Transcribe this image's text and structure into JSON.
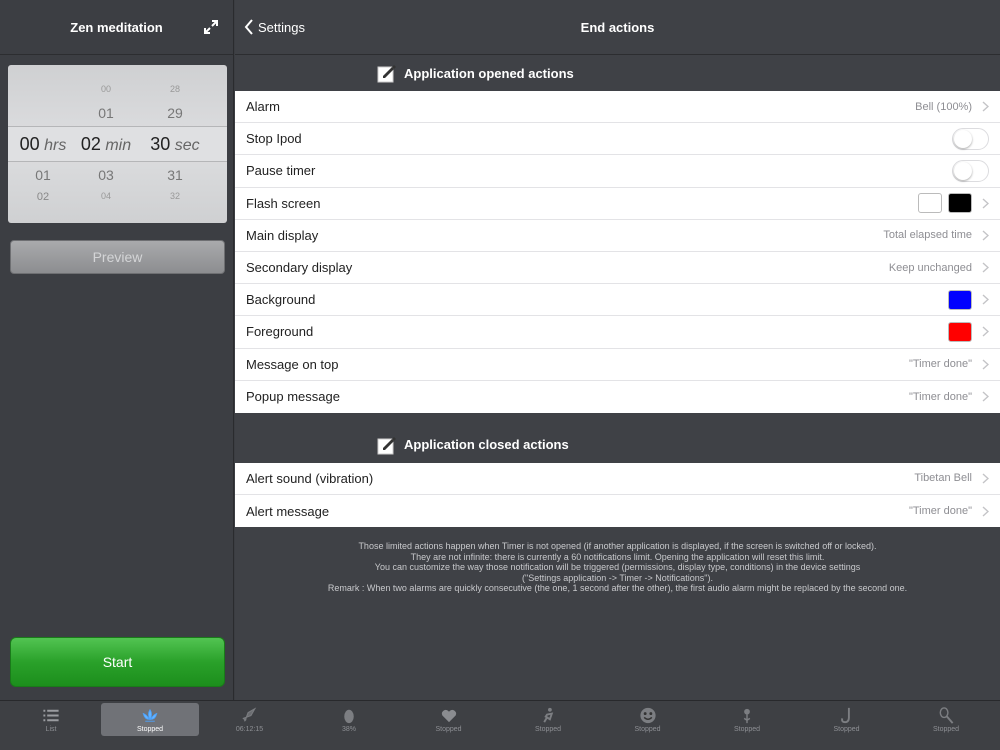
{
  "left": {
    "title": "Zen meditation",
    "picker": {
      "hours": {
        "above_far": "",
        "above": "",
        "selected": "00",
        "unit": "hrs",
        "below": "01",
        "below_far": "02"
      },
      "minutes": {
        "above_far": "00",
        "above": "01",
        "selected": "02",
        "unit": "min",
        "below": "03",
        "below_far": "04"
      },
      "seconds": {
        "above_far": "28",
        "above": "29",
        "selected": "30",
        "unit": "sec",
        "below": "31",
        "below_far": "32"
      }
    },
    "preview_label": "Preview",
    "start_label": "Start"
  },
  "nav": {
    "back_label": "Settings",
    "title": "End actions"
  },
  "opened_section": {
    "title": "Application opened actions",
    "rows": [
      {
        "label": "Alarm",
        "detail": "Bell (100%)"
      },
      {
        "label": "Stop Ipod",
        "toggle": false
      },
      {
        "label": "Pause timer",
        "toggle": false
      },
      {
        "label": "Flash screen",
        "colors": [
          "#ffffff",
          "#000000"
        ]
      },
      {
        "label": "Main display",
        "detail": "Total elapsed time"
      },
      {
        "label": "Secondary display",
        "detail": "Keep unchanged"
      },
      {
        "label": "Background",
        "colors": [
          "#0000ff"
        ]
      },
      {
        "label": "Foreground",
        "colors": [
          "#ff0000"
        ]
      },
      {
        "label": "Message on top",
        "detail": "\"Timer done\""
      },
      {
        "label": "Popup message",
        "detail": "\"Timer done\""
      }
    ]
  },
  "closed_section": {
    "title": "Application closed actions",
    "rows": [
      {
        "label": "Alert sound (vibration)",
        "detail": "Tibetan Bell"
      },
      {
        "label": "Alert message",
        "detail": "\"Timer done\""
      }
    ]
  },
  "footer_note": [
    "Those limited actions happen when Timer is not opened (if another application is displayed, if the screen is switched off or locked).",
    "They are not infinite: there is currently a 60 notifications limit. Opening the application will reset this limit.",
    "You can customize the way those notification will be triggered (permissions, display type, conditions) in the device settings",
    "(\"Settings application -> Timer -> Notifications\").",
    "Remark : When two alarms are quickly consecutive (the one, 1 second after the other), the first audio alarm might be replaced by the second one."
  ],
  "tabs": [
    {
      "icon": "list-icon",
      "label": "List",
      "active": false
    },
    {
      "icon": "lotus-icon",
      "label": "Stopped",
      "active": true
    },
    {
      "icon": "rocket-icon",
      "label": "06:12:15",
      "active": false
    },
    {
      "icon": "egg-icon",
      "label": "38%",
      "active": false
    },
    {
      "icon": "heart-icon",
      "label": "Stopped",
      "active": false
    },
    {
      "icon": "runner-icon",
      "label": "Stopped",
      "active": false
    },
    {
      "icon": "smiley-icon",
      "label": "Stopped",
      "active": false
    },
    {
      "icon": "flower-icon",
      "label": "Stopped",
      "active": false
    },
    {
      "icon": "saxophone-icon",
      "label": "Stopped",
      "active": false
    },
    {
      "icon": "racket-icon",
      "label": "Stopped",
      "active": false
    }
  ],
  "colors": {
    "start_green": "#2aa12a",
    "background_dark": "#3f4146"
  }
}
